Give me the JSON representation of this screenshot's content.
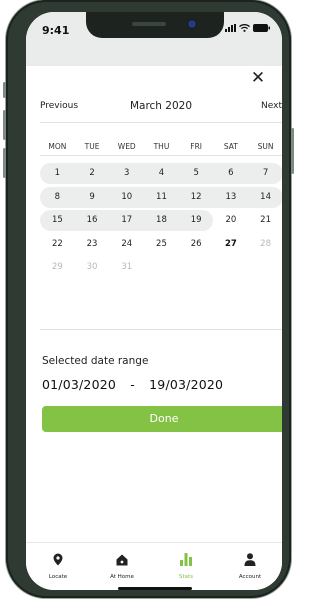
{
  "status_bar": {
    "time": "9:41"
  },
  "calendar": {
    "previous_label": "Previous",
    "month_label": "March 2020",
    "next_label": "Next",
    "weekdays": [
      "MON",
      "TUE",
      "WED",
      "THU",
      "FRI",
      "SAT",
      "SUN"
    ],
    "weeks": [
      [
        "1",
        "2",
        "3",
        "4",
        "5",
        "6",
        "7"
      ],
      [
        "8",
        "9",
        "10",
        "11",
        "12",
        "13",
        "14"
      ],
      [
        "15",
        "16",
        "17",
        "18",
        "19",
        "20",
        "21"
      ],
      [
        "22",
        "23",
        "24",
        "25",
        "26",
        "27",
        "28"
      ],
      [
        "29",
        "30",
        "31",
        "",
        "",
        "",
        ""
      ]
    ]
  },
  "selection": {
    "label": "Selected date range",
    "start": "01/03/2020",
    "separator": "-",
    "end": "19/03/2020"
  },
  "done_label": "Done",
  "accent_color": "#84c245",
  "tabs": [
    {
      "label": "Locate",
      "icon": "location-pin-icon"
    },
    {
      "label": "At Home",
      "icon": "house-icon"
    },
    {
      "label": "Stats",
      "icon": "bar-chart-icon",
      "active": true
    },
    {
      "label": "Account",
      "icon": "person-icon"
    }
  ]
}
